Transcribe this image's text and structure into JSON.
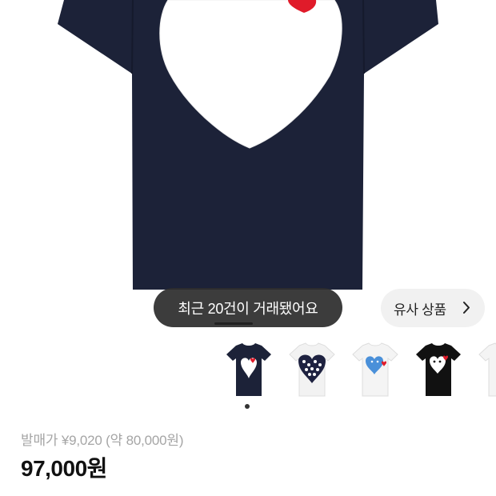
{
  "product": {
    "trade_notice": "최근 20건이 거래됐어요",
    "similar_button_label": "유사 상품",
    "release_price_label": "발매가",
    "release_price_value": "¥9,020 (약 80,000원)",
    "price": "97,000원",
    "thumbnails": [
      {
        "name": "navy-white-heart",
        "shirt_color": "#1c2238",
        "heart_color": "#ffffff"
      },
      {
        "name": "white-polka-heart",
        "shirt_color": "#f2f2f2",
        "heart_color": "#1e2240"
      },
      {
        "name": "white-blue-heart",
        "shirt_color": "#f4f4f4",
        "heart_color": "#4a90d9"
      },
      {
        "name": "black-white-heart",
        "shirt_color": "#111111",
        "heart_color": "#ffffff"
      },
      {
        "name": "white-partial",
        "shirt_color": "#f4f4f4",
        "heart_color": "#ffffff"
      }
    ]
  },
  "colors": {
    "shirt_navy": "#1c2238",
    "heart_red": "#e01b2a",
    "pill_bg": "#2d2d2d",
    "similar_bg": "#f1f1f1",
    "muted_text": "#a5a5a5"
  },
  "icons": {
    "similar_chevron": "chevron-right-icon"
  }
}
